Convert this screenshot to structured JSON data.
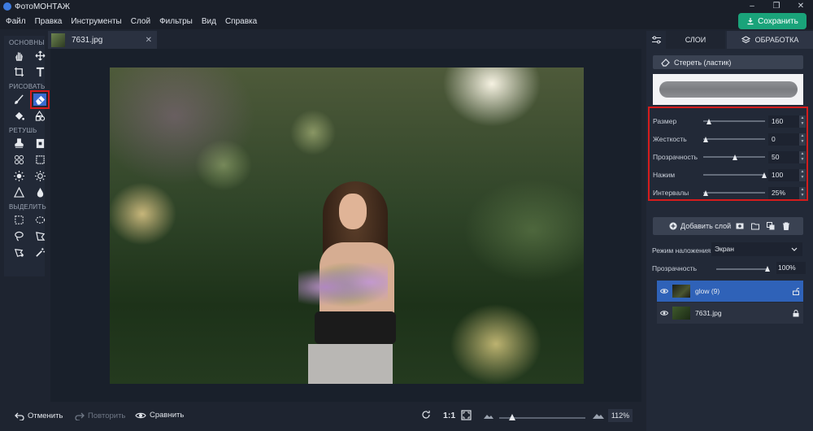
{
  "app": {
    "title": "ФотоМОНТАЖ"
  },
  "window_controls": {
    "minimize": "–",
    "maximize": "❐",
    "close": "✕"
  },
  "menu": [
    "Файл",
    "Правка",
    "Инструменты",
    "Слой",
    "Фильтры",
    "Вид",
    "Справка"
  ],
  "save_button": {
    "label": "Сохранить",
    "color": "#1aa37a"
  },
  "toolbar": {
    "sections": {
      "basic": "ОСНОВНЫЕ",
      "draw": "РИСОВАТЬ",
      "retouch": "РЕТУШЬ",
      "select": "ВЫДЕЛИТЬ"
    },
    "tools": {
      "basic": [
        "hand-icon",
        "move-icon",
        "crop-icon",
        "text-icon"
      ],
      "draw": [
        "brush-icon",
        "eraser-icon",
        "fill-icon",
        "shapes-icon"
      ],
      "retouch": [
        "stamp-icon",
        "patch-icon",
        "heal-icon",
        "frame-icon",
        "brighten-icon",
        "darken-icon",
        "sharpen-icon",
        "blur-icon"
      ],
      "select": [
        "rect-select-icon",
        "ellipse-select-icon",
        "lasso-icon",
        "polygon-lasso-icon",
        "magnetic-lasso-icon",
        "magic-wand-icon"
      ]
    },
    "active_tool": "eraser-icon",
    "highlight_color": "#d51c1c"
  },
  "document": {
    "tab_name": "7631.jpg",
    "close": "✕"
  },
  "bottom": {
    "undo": "Отменить",
    "redo": "Повторить",
    "compare": "Сравнить",
    "one_to_one": "1:1",
    "zoom": "112%",
    "zoom_level": 0.12
  },
  "panel": {
    "tabs": {
      "layers": "СЛОИ",
      "processing": "ОБРАБОТКА"
    },
    "erase_button": "Стереть (ластик)",
    "params": [
      {
        "label": "Размер",
        "value": "160",
        "level": 0.05
      },
      {
        "label": "Жесткость",
        "value": "0",
        "level": 0.0
      },
      {
        "label": "Прозрачность",
        "value": "50",
        "level": 0.5
      },
      {
        "label": "Нажим",
        "value": "100",
        "level": 1.0
      },
      {
        "label": "Интервалы",
        "value": "25%",
        "level": 0.0
      }
    ],
    "spin_up": "▲",
    "spin_down": "▼",
    "add_layer": "Добавить слой",
    "blend_label": "Режим наложения:",
    "blend_value": "Экран",
    "opacity_label": "Прозрачность",
    "opacity_value": "100%",
    "opacity_level": 1.0,
    "layers": [
      {
        "name": "glow (9)",
        "selected": true
      },
      {
        "name": "7631.jpg",
        "selected": false
      }
    ]
  },
  "colors": {
    "background": "#1e2430",
    "panel": "#222937",
    "accent_blue": "#2f62b8",
    "accent_green": "#1aa37a"
  }
}
